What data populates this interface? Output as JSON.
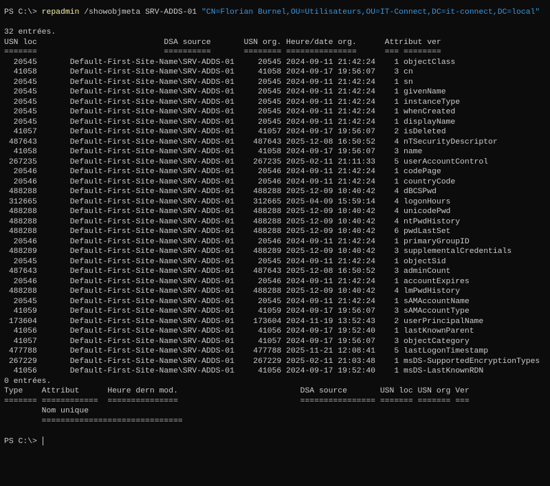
{
  "prompt": "PS C:\\>",
  "command": {
    "name": "repadmin",
    "args": "/showobjmeta SRV-ADDS-01",
    "string_arg": "\"CN=Florian Burnel,OU=Utilisateurs,OU=IT-Connect,DC=it-connect,DC=local\""
  },
  "meta_section": {
    "count_label": "32 entrées.",
    "headers": {
      "usn_loc": "USN loc",
      "dsa_source": "DSA source",
      "usn_org": "USN org.",
      "date_org": "Heure/date org.",
      "attribut": "Attribut",
      "ver": "ver"
    },
    "separators": {
      "usn_loc": "=======",
      "dsa_source": "==========",
      "usn_org": "========",
      "date_org": "===============",
      "ver": "===",
      "attribut": "========"
    },
    "rows": [
      [
        "20545",
        "Default-First-Site-Name\\SRV-ADDS-01",
        "20545",
        "2024-09-11 21:42:24",
        "1",
        "objectClass"
      ],
      [
        "41058",
        "Default-First-Site-Name\\SRV-ADDS-01",
        "41058",
        "2024-09-17 19:56:07",
        "3",
        "cn"
      ],
      [
        "20545",
        "Default-First-Site-Name\\SRV-ADDS-01",
        "20545",
        "2024-09-11 21:42:24",
        "1",
        "sn"
      ],
      [
        "20545",
        "Default-First-Site-Name\\SRV-ADDS-01",
        "20545",
        "2024-09-11 21:42:24",
        "1",
        "givenName"
      ],
      [
        "20545",
        "Default-First-Site-Name\\SRV-ADDS-01",
        "20545",
        "2024-09-11 21:42:24",
        "1",
        "instanceType"
      ],
      [
        "20545",
        "Default-First-Site-Name\\SRV-ADDS-01",
        "20545",
        "2024-09-11 21:42:24",
        "1",
        "whenCreated"
      ],
      [
        "20545",
        "Default-First-Site-Name\\SRV-ADDS-01",
        "20545",
        "2024-09-11 21:42:24",
        "1",
        "displayName"
      ],
      [
        "41057",
        "Default-First-Site-Name\\SRV-ADDS-01",
        "41057",
        "2024-09-17 19:56:07",
        "2",
        "isDeleted"
      ],
      [
        "487643",
        "Default-First-Site-Name\\SRV-ADDS-01",
        "487643",
        "2025-12-08 16:50:52",
        "4",
        "nTSecurityDescriptor"
      ],
      [
        "41058",
        "Default-First-Site-Name\\SRV-ADDS-01",
        "41058",
        "2024-09-17 19:56:07",
        "3",
        "name"
      ],
      [
        "267235",
        "Default-First-Site-Name\\SRV-ADDS-01",
        "267235",
        "2025-02-11 21:11:33",
        "5",
        "userAccountControl"
      ],
      [
        "20546",
        "Default-First-Site-Name\\SRV-ADDS-01",
        "20546",
        "2024-09-11 21:42:24",
        "1",
        "codePage"
      ],
      [
        "20546",
        "Default-First-Site-Name\\SRV-ADDS-01",
        "20546",
        "2024-09-11 21:42:24",
        "1",
        "countryCode"
      ],
      [
        "488288",
        "Default-First-Site-Name\\SRV-ADDS-01",
        "488288",
        "2025-12-09 10:40:42",
        "4",
        "dBCSPwd"
      ],
      [
        "312665",
        "Default-First-Site-Name\\SRV-ADDS-01",
        "312665",
        "2025-04-09 15:59:14",
        "4",
        "logonHours"
      ],
      [
        "488288",
        "Default-First-Site-Name\\SRV-ADDS-01",
        "488288",
        "2025-12-09 10:40:42",
        "4",
        "unicodePwd"
      ],
      [
        "488288",
        "Default-First-Site-Name\\SRV-ADDS-01",
        "488288",
        "2025-12-09 10:40:42",
        "4",
        "ntPwdHistory"
      ],
      [
        "488288",
        "Default-First-Site-Name\\SRV-ADDS-01",
        "488288",
        "2025-12-09 10:40:42",
        "6",
        "pwdLastSet"
      ],
      [
        "20546",
        "Default-First-Site-Name\\SRV-ADDS-01",
        "20546",
        "2024-09-11 21:42:24",
        "1",
        "primaryGroupID"
      ],
      [
        "488289",
        "Default-First-Site-Name\\SRV-ADDS-01",
        "488289",
        "2025-12-09 10:40:42",
        "3",
        "supplementalCredentials"
      ],
      [
        "20545",
        "Default-First-Site-Name\\SRV-ADDS-01",
        "20545",
        "2024-09-11 21:42:24",
        "1",
        "objectSid"
      ],
      [
        "487643",
        "Default-First-Site-Name\\SRV-ADDS-01",
        "487643",
        "2025-12-08 16:50:52",
        "3",
        "adminCount"
      ],
      [
        "20546",
        "Default-First-Site-Name\\SRV-ADDS-01",
        "20546",
        "2024-09-11 21:42:24",
        "1",
        "accountExpires"
      ],
      [
        "488288",
        "Default-First-Site-Name\\SRV-ADDS-01",
        "488288",
        "2025-12-09 10:40:42",
        "4",
        "lmPwdHistory"
      ],
      [
        "20545",
        "Default-First-Site-Name\\SRV-ADDS-01",
        "20545",
        "2024-09-11 21:42:24",
        "1",
        "sAMAccountName"
      ],
      [
        "41059",
        "Default-First-Site-Name\\SRV-ADDS-01",
        "41059",
        "2024-09-17 19:56:07",
        "3",
        "sAMAccountType"
      ],
      [
        "173604",
        "Default-First-Site-Name\\SRV-ADDS-01",
        "173604",
        "2024-11-19 13:52:43",
        "2",
        "userPrincipalName"
      ],
      [
        "41056",
        "Default-First-Site-Name\\SRV-ADDS-01",
        "41056",
        "2024-09-17 19:52:40",
        "1",
        "lastKnownParent"
      ],
      [
        "41057",
        "Default-First-Site-Name\\SRV-ADDS-01",
        "41057",
        "2024-09-17 19:56:07",
        "3",
        "objectCategory"
      ],
      [
        "477788",
        "Default-First-Site-Name\\SRV-ADDS-01",
        "477788",
        "2025-11-21 12:08:41",
        "5",
        "lastLogonTimestamp"
      ],
      [
        "267229",
        "Default-First-Site-Name\\SRV-ADDS-01",
        "267229",
        "2025-02-11 21:03:48",
        "1",
        "msDS-SupportedEncryptionTypes"
      ],
      [
        "41056",
        "Default-First-Site-Name\\SRV-ADDS-01",
        "41056",
        "2024-09-17 19:52:40",
        "1",
        "msDS-LastKnownRDN"
      ]
    ]
  },
  "value_section": {
    "count_label": "0 entrées.",
    "headers": {
      "type": "Type",
      "attribut": "Attribut",
      "heure": "Heure dern mod.",
      "dsa_source": "DSA source",
      "usn_loc": "USN loc",
      "usn_org": "USN org",
      "ver": "Ver",
      "nom_unique": "Nom unique"
    },
    "separators": {
      "type": "=======",
      "attribut": "============",
      "heure": "===============",
      "dsa_source": "================",
      "usn_loc": "=======",
      "usn_org": "=======",
      "ver": "===",
      "nom_unique": "=============================="
    }
  }
}
